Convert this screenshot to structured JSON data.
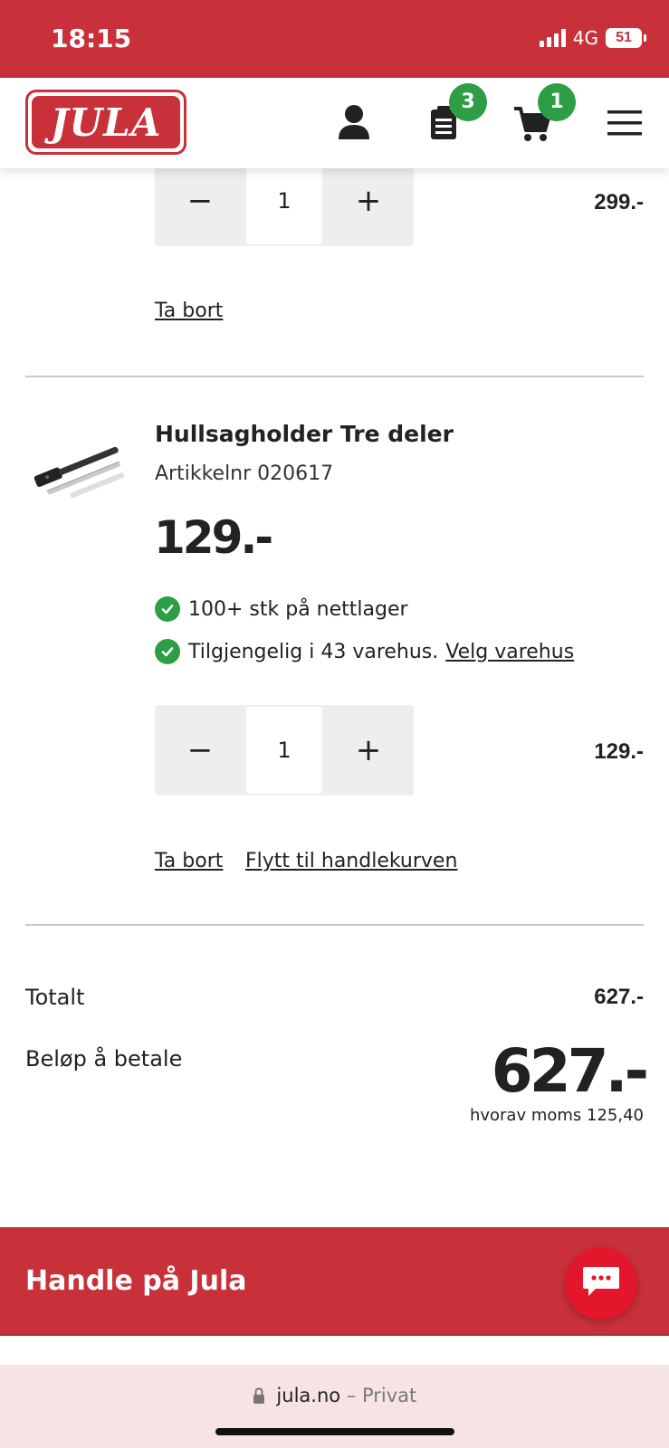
{
  "status_bar": {
    "time": "18:15",
    "network": "4G",
    "battery": "51"
  },
  "header": {
    "logo_text": "JULA",
    "wishlist_badge": "3",
    "cart_badge": "1",
    "icons": [
      "user-icon",
      "clipboard-icon",
      "cart-icon",
      "hamburger-menu-icon"
    ]
  },
  "cart": {
    "item1": {
      "quantity": "1",
      "line_price": "299.-",
      "remove_label": "Ta bort"
    },
    "item2": {
      "title": "Hullsagholder Tre deler",
      "article_number": "Artikkelnr 020617",
      "price": "129.-",
      "stock_online": "100+ stk på nettlager",
      "stock_store": "Tilgjengelig i 43 varehus.",
      "choose_store_label": "Velg varehus",
      "quantity": "1",
      "line_price": "129.-",
      "remove_label": "Ta bort",
      "move_label": "Flytt til handlekurven"
    }
  },
  "summary": {
    "total_label": "Totalt",
    "total_value": "627.-",
    "pay_label": "Beløp å betale",
    "pay_value": "627.-",
    "vat_text": "hvorav moms 125,40"
  },
  "footer": {
    "title": "Handle på Jula"
  },
  "browser": {
    "domain": "jula.no",
    "mode": "– Privat"
  },
  "colors": {
    "brand_red": "#c8313a",
    "stock_green": "#2e9e45",
    "chat_red": "#e4162b"
  }
}
